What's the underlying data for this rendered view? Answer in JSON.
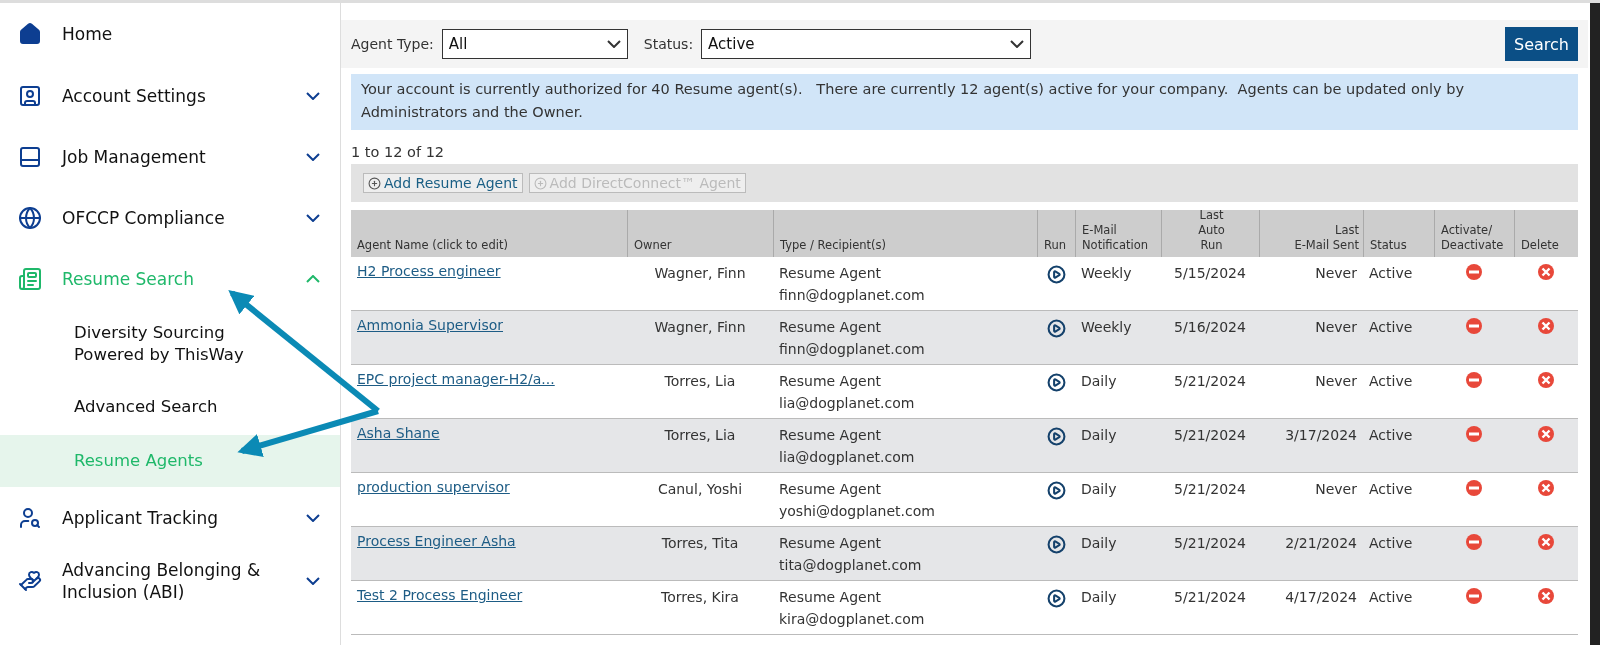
{
  "sidebar": {
    "items": [
      {
        "label": "Home",
        "kind": "link",
        "selected": false
      },
      {
        "label": "Account Settings",
        "kind": "group",
        "expanded": false,
        "selected": false
      },
      {
        "label": "Job Management",
        "kind": "group",
        "expanded": false,
        "selected": false
      },
      {
        "label": "OFCCP Compliance",
        "kind": "group",
        "expanded": false,
        "selected": false
      },
      {
        "label": "Resume Search",
        "kind": "group",
        "expanded": true,
        "selected": true,
        "children": [
          {
            "label": "Diversity Sourcing Powered by ThisWay",
            "selected": false
          },
          {
            "label": "Advanced Search",
            "selected": false
          },
          {
            "label": "Resume Agents",
            "selected": true
          }
        ]
      },
      {
        "label": "Applicant Tracking",
        "kind": "group",
        "expanded": false,
        "selected": false
      },
      {
        "label": "Advancing Belonging & Inclusion (ABI)",
        "kind": "group",
        "expanded": false,
        "selected": false
      }
    ]
  },
  "filters": {
    "agent_type": {
      "label": "Agent Type:",
      "value": "All"
    },
    "status": {
      "label": "Status:",
      "value": "Active"
    },
    "search_button": "Search"
  },
  "notice": "Your account is currently authorized for 40 Resume agent(s).   There are currently 12 agent(s) active for your company.  Agents can be updated only by Administrators and the Owner.",
  "count": "1 to 12 of 12",
  "toolbar": [
    {
      "label": "Add Resume Agent",
      "disabled": false
    },
    {
      "label": "Add DirectConnect™ Agent",
      "disabled": true
    }
  ],
  "table": {
    "columns": [
      {
        "label": "Agent Name (click to edit)"
      },
      {
        "label": "Owner"
      },
      {
        "label": "Type / Recipient(s)"
      },
      {
        "label": "Run"
      },
      {
        "label": "E-Mail\nNotification"
      },
      {
        "label": "Last\nAuto\nRun"
      },
      {
        "label": "Last\nE-Mail Sent"
      },
      {
        "label": "Status"
      },
      {
        "label": "Activate/\nDeactivate"
      },
      {
        "label": "Delete"
      }
    ],
    "rows": [
      {
        "name": "H2 Process engineer",
        "owner": "Wagner, Finn",
        "type": "Resume Agent",
        "recipient": "finn@dogplanet.com",
        "notification": "Weekly",
        "last_auto_run": "5/15/2024",
        "last_email_sent": "Never",
        "status": "Active"
      },
      {
        "name": "Ammonia Supervisor",
        "owner": "Wagner, Finn",
        "type": "Resume Agent",
        "recipient": "finn@dogplanet.com",
        "notification": "Weekly",
        "last_auto_run": "5/16/2024",
        "last_email_sent": "Never",
        "status": "Active"
      },
      {
        "name": "EPC project manager-H2/a...",
        "owner": "Torres, Lia",
        "type": "Resume Agent",
        "recipient": "lia@dogplanet.com",
        "notification": "Daily",
        "last_auto_run": "5/21/2024",
        "last_email_sent": "Never",
        "status": "Active"
      },
      {
        "name": "Asha Shane",
        "owner": "Torres, Lia",
        "type": "Resume Agent",
        "recipient": "lia@dogplanet.com",
        "notification": "Daily",
        "last_auto_run": "5/21/2024",
        "last_email_sent": "3/17/2024",
        "status": "Active"
      },
      {
        "name": "production supervisor",
        "owner": "Canul, Yoshi",
        "type": "Resume Agent",
        "recipient": "yoshi@dogplanet.com",
        "notification": "Daily",
        "last_auto_run": "5/21/2024",
        "last_email_sent": "Never",
        "status": "Active"
      },
      {
        "name": "Process Engineer Asha",
        "owner": "Torres, Tita",
        "type": "Resume Agent",
        "recipient": "tita@dogplanet.com",
        "notification": "Daily",
        "last_auto_run": "5/21/2024",
        "last_email_sent": "2/21/2024",
        "status": "Active"
      },
      {
        "name": "Test 2 Process Engineer",
        "owner": "Torres, Kira",
        "type": "Resume Agent",
        "recipient": "kira@dogplanet.com",
        "notification": "Daily",
        "last_auto_run": "5/21/2024",
        "last_email_sent": "4/17/2024",
        "status": "Active"
      }
    ]
  }
}
